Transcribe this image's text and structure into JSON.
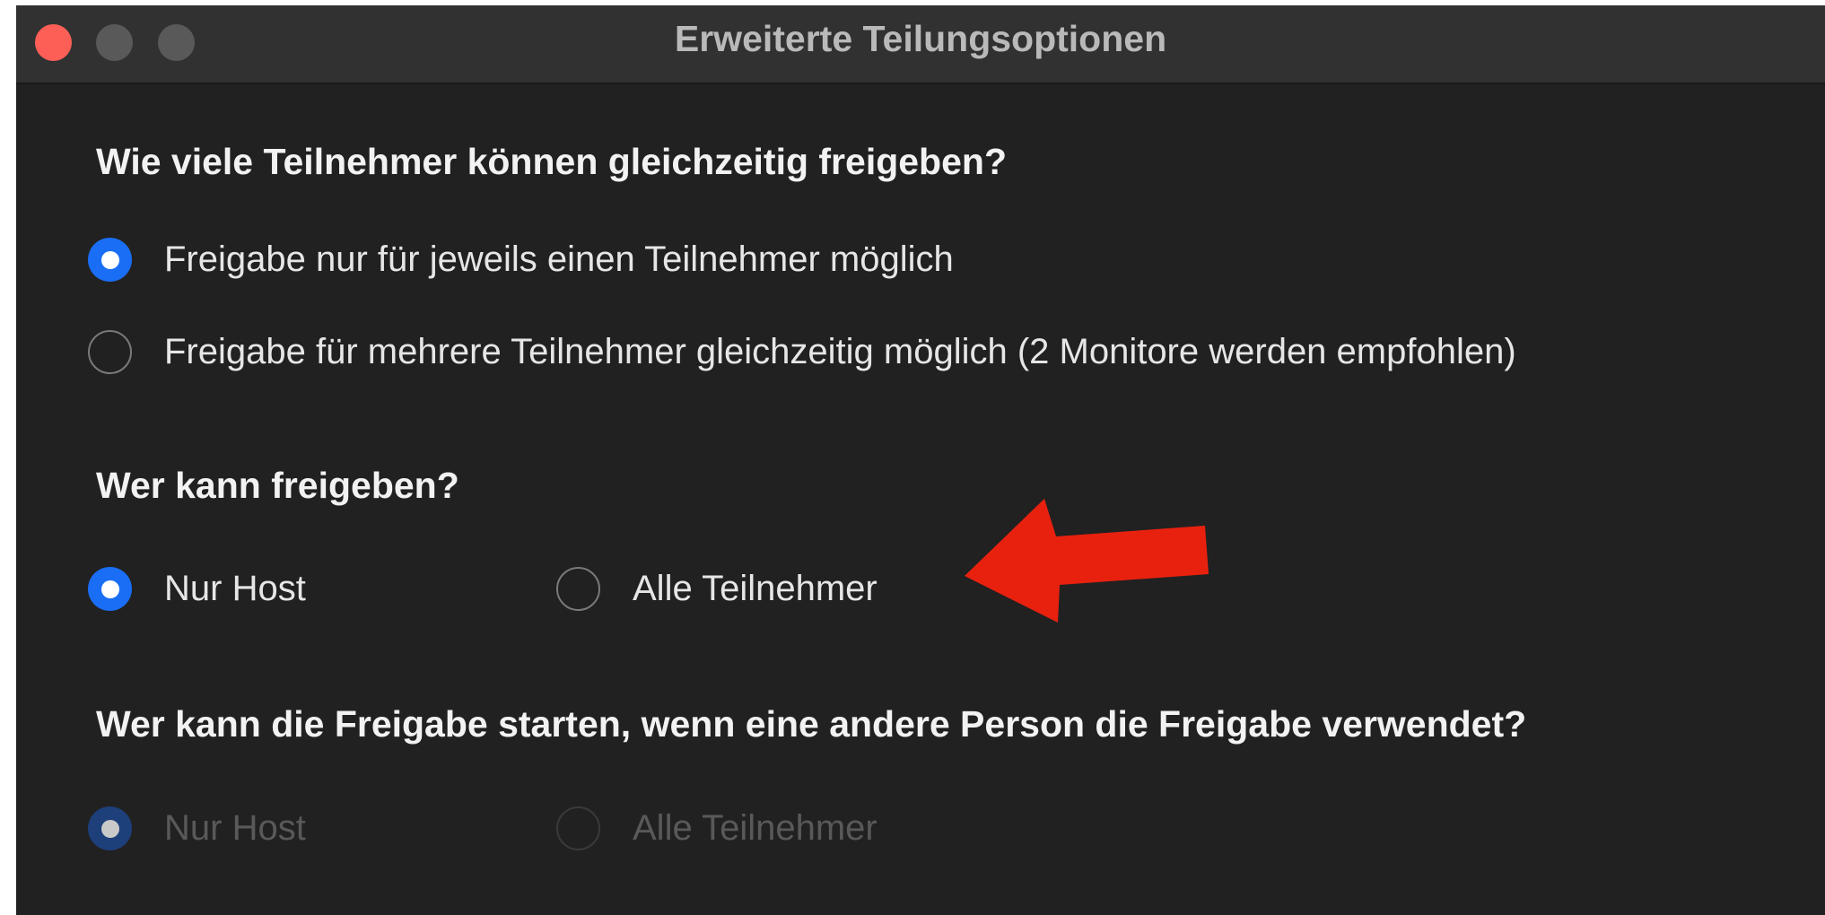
{
  "window": {
    "title": "Erweiterte Teilungsoptionen"
  },
  "section1": {
    "heading": "Wie viele Teilnehmer können gleichzeitig freigeben?",
    "options": [
      {
        "label": "Freigabe nur für jeweils einen Teilnehmer möglich",
        "selected": true
      },
      {
        "label": "Freigabe für mehrere Teilnehmer gleichzeitig möglich (2 Monitore werden empfohlen)",
        "selected": false
      }
    ]
  },
  "section2": {
    "heading": "Wer kann freigeben?",
    "options": [
      {
        "label": "Nur Host",
        "selected": true
      },
      {
        "label": "Alle Teilnehmer",
        "selected": false
      }
    ]
  },
  "section3": {
    "heading": "Wer kann die Freigabe starten, wenn eine andere Person die Freigabe verwendet?",
    "disabled": true,
    "options": [
      {
        "label": "Nur Host",
        "selected": true
      },
      {
        "label": "Alle Teilnehmer",
        "selected": false
      }
    ]
  },
  "colors": {
    "window_bg": "#212121",
    "titlebar_bg": "#313131",
    "accent_blue": "#1a6ef5",
    "annotation_arrow": "#e8210f",
    "close_button": "#fd5f57"
  },
  "annotation": {
    "icon": "red-arrow-left-icon"
  }
}
